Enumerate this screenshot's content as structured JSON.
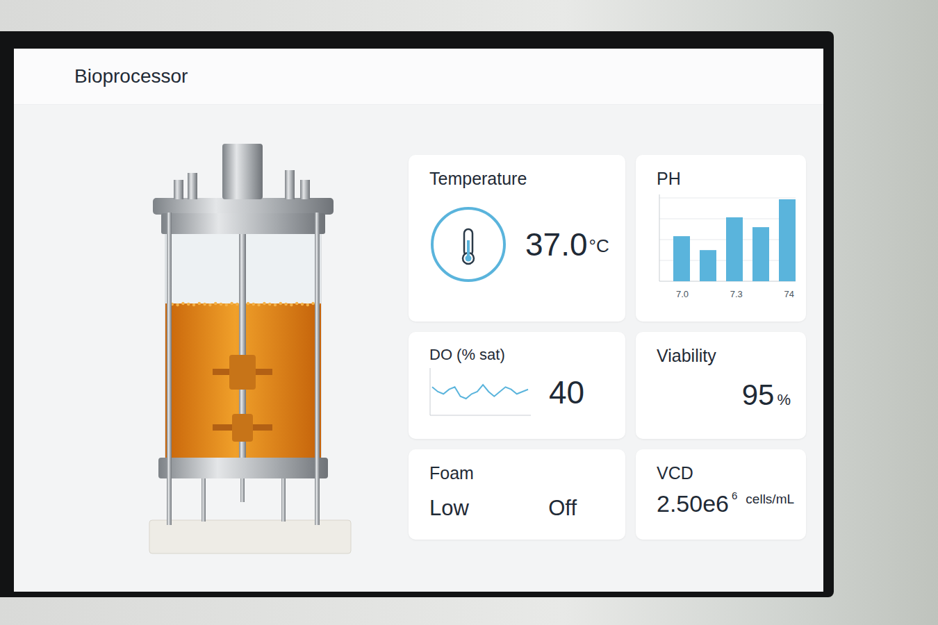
{
  "window": {
    "title": "Bioprocessor"
  },
  "temperature": {
    "label": "Temperature",
    "value": "37.0",
    "unit": "°C"
  },
  "ph": {
    "label": "PH",
    "values": [
      55,
      38,
      78,
      66,
      100
    ],
    "ticks": [
      "7.0",
      "7.3",
      "74"
    ]
  },
  "dissolved_oxygen": {
    "label": "DO (% sat)",
    "value": "40",
    "trend": [
      40,
      39,
      38.5,
      39.5,
      40,
      38,
      37.5,
      38.5,
      39,
      40.5,
      39,
      38,
      39,
      40,
      39.5,
      38.5,
      39,
      39.5
    ]
  },
  "viability": {
    "label": "Viability",
    "value": "95",
    "unit": "%"
  },
  "foam": {
    "label": "Foam",
    "level_text": "Low",
    "state": "Off"
  },
  "vcd": {
    "label": "VCD",
    "value": "2.50e6",
    "superscript": "6",
    "unit": "cells/mL"
  }
}
